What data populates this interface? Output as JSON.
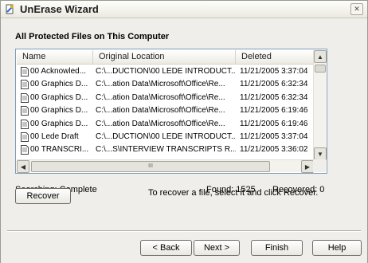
{
  "window": {
    "title": "UnErase Wizard",
    "close_glyph": "✕"
  },
  "heading": "All Protected Files on This Computer",
  "list": {
    "columns": [
      "Name",
      "Original Location",
      "Deleted"
    ],
    "rows": [
      [
        "00 Acknowled...",
        "C:\\...DUCTION\\00 LEDE INTRODUCT...",
        "11/21/2005 3:37:04"
      ],
      [
        "00 Graphics D...",
        "C:\\...ation Data\\Microsoft\\Office\\Re...",
        "11/21/2005 6:32:34"
      ],
      [
        "00 Graphics D...",
        "C:\\...ation Data\\Microsoft\\Office\\Re...",
        "11/21/2005 6:32:34"
      ],
      [
        "00 Graphics D...",
        "C:\\...ation Data\\Microsoft\\Office\\Re...",
        "11/21/2005 6:19:46"
      ],
      [
        "00 Graphics D...",
        "C:\\...ation Data\\Microsoft\\Office\\Re...",
        "11/21/2005 6:19:46"
      ],
      [
        "00 Lede Draft",
        "C:\\...DUCTION\\00 LEDE INTRODUCT...",
        "11/21/2005 3:37:04"
      ],
      [
        "00 TRANSCRI...",
        "C:\\...S\\INTERVIEW TRANSCRIPTS R...",
        "11/21/2005 3:36:02"
      ]
    ],
    "row_icon": "document-icon"
  },
  "status": {
    "searching": "Searching:  Complete",
    "found": "Found: 1525",
    "recovered": "Recovered: 0"
  },
  "recover_button": "Recover",
  "hint": "To recover a file, select it and click Recover.",
  "nav": {
    "back": "< Back",
    "next": "Next >",
    "finish": "Finish",
    "help": "Help"
  },
  "scrollbar_glyphs": {
    "up": "▲",
    "down": "▼",
    "left": "◀",
    "right": "▶",
    "grip": "III"
  }
}
